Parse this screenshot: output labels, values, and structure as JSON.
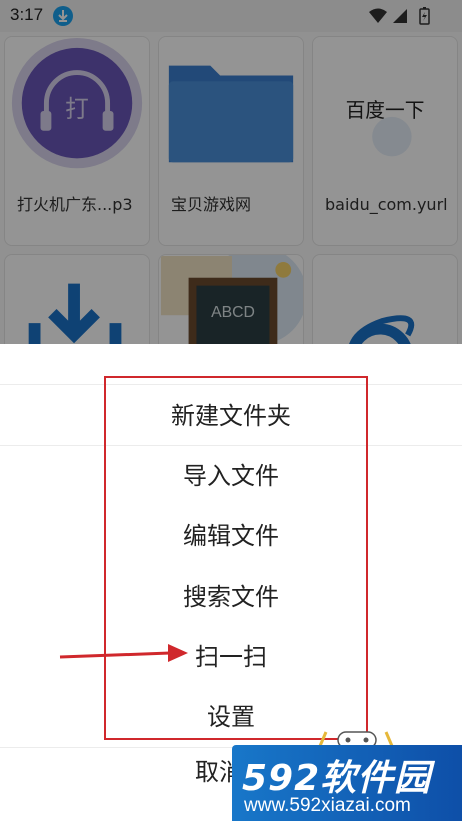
{
  "status_bar": {
    "time": "3:17"
  },
  "files": [
    {
      "name": "打火机广东...p3",
      "thumb_icon": "headphones-icon"
    },
    {
      "name": "宝贝游戏网",
      "thumb_icon": "folder-icon"
    },
    {
      "name": "baidu_com.yurl",
      "thumb_icon": "web-link-icon",
      "thumb_text": "百度一下"
    },
    {
      "name": "",
      "thumb_icon": "download-icon"
    },
    {
      "name": "",
      "thumb_icon": "book-icon",
      "thumb_text": "ABCD"
    },
    {
      "name": "",
      "thumb_icon": "ie-browser-icon"
    }
  ],
  "menu": {
    "items": [
      "新建文件夹",
      "导入文件",
      "编辑文件",
      "搜索文件",
      "扫一扫",
      "设置"
    ],
    "cancel": "取消"
  },
  "watermark": {
    "brand": "592软件园",
    "url": "www.592xiazai.com"
  },
  "colors": {
    "highlight": "#d0282c",
    "folder": "#4a90d9",
    "ie_blue": "#1a73c9",
    "status_download": "#1aa2f0"
  }
}
